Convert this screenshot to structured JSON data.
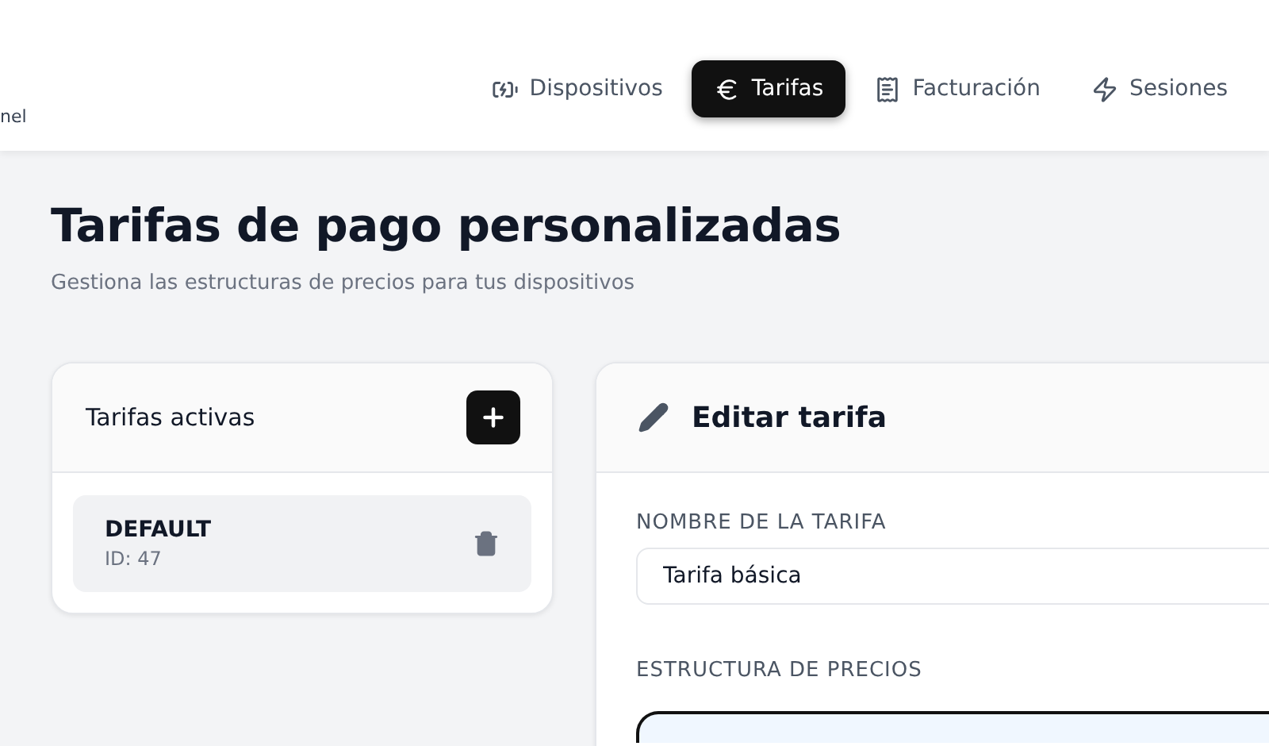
{
  "header": {
    "brand_fragment": "nel",
    "tabs": [
      {
        "label": "Dispositivos",
        "selected": false
      },
      {
        "label": "Tarifas",
        "selected": true
      },
      {
        "label": "Facturación",
        "selected": false
      },
      {
        "label": "Sesiones",
        "selected": false
      }
    ]
  },
  "page": {
    "title": "Tarifas de pago personalizadas",
    "subtitle": "Gestiona las estructuras de precios para tus dispositivos"
  },
  "tariff_list": {
    "title": "Tarifas activas",
    "items": [
      {
        "name": "DEFAULT",
        "id": "ID: 47",
        "selected": true
      }
    ]
  },
  "editor": {
    "title": "Editar tarifa",
    "name_label": "NOMBRE DE LA TARIFA",
    "name_value": "Tarifa básica",
    "structure_label": "ESTRUCTURA DE PRECIOS"
  }
}
